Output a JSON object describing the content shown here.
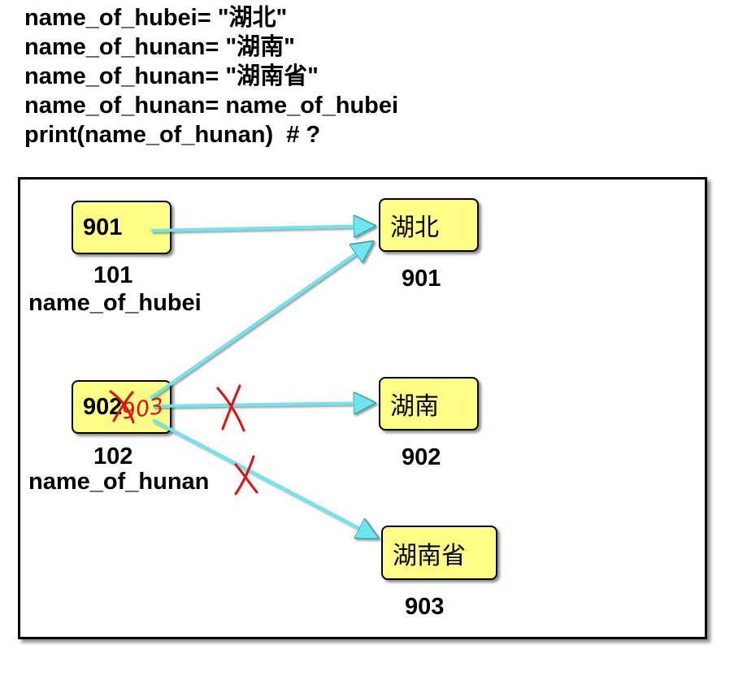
{
  "code_lines": [
    "name_of_hubei= \"湖北\"",
    "name_of_hunan= \"湖南\"",
    "name_of_hunan= \"湖南省\"",
    "name_of_hunan= name_of_hubei",
    "print(name_of_hunan)  # ?"
  ],
  "variables": [
    {
      "value": "901",
      "address": "101",
      "name": "name_of_hubei"
    },
    {
      "value": "902",
      "address": "102",
      "name": "name_of_hunan",
      "overwritten_value_annotation": "903"
    }
  ],
  "objects": [
    {
      "text": "湖北",
      "address": "901"
    },
    {
      "text": "湖南",
      "address": "902"
    },
    {
      "text": "湖南省",
      "address": "903"
    }
  ],
  "colors": {
    "arrow": "#6ee6ee",
    "box_fill": "#ffff88",
    "strike": "#e01010"
  }
}
